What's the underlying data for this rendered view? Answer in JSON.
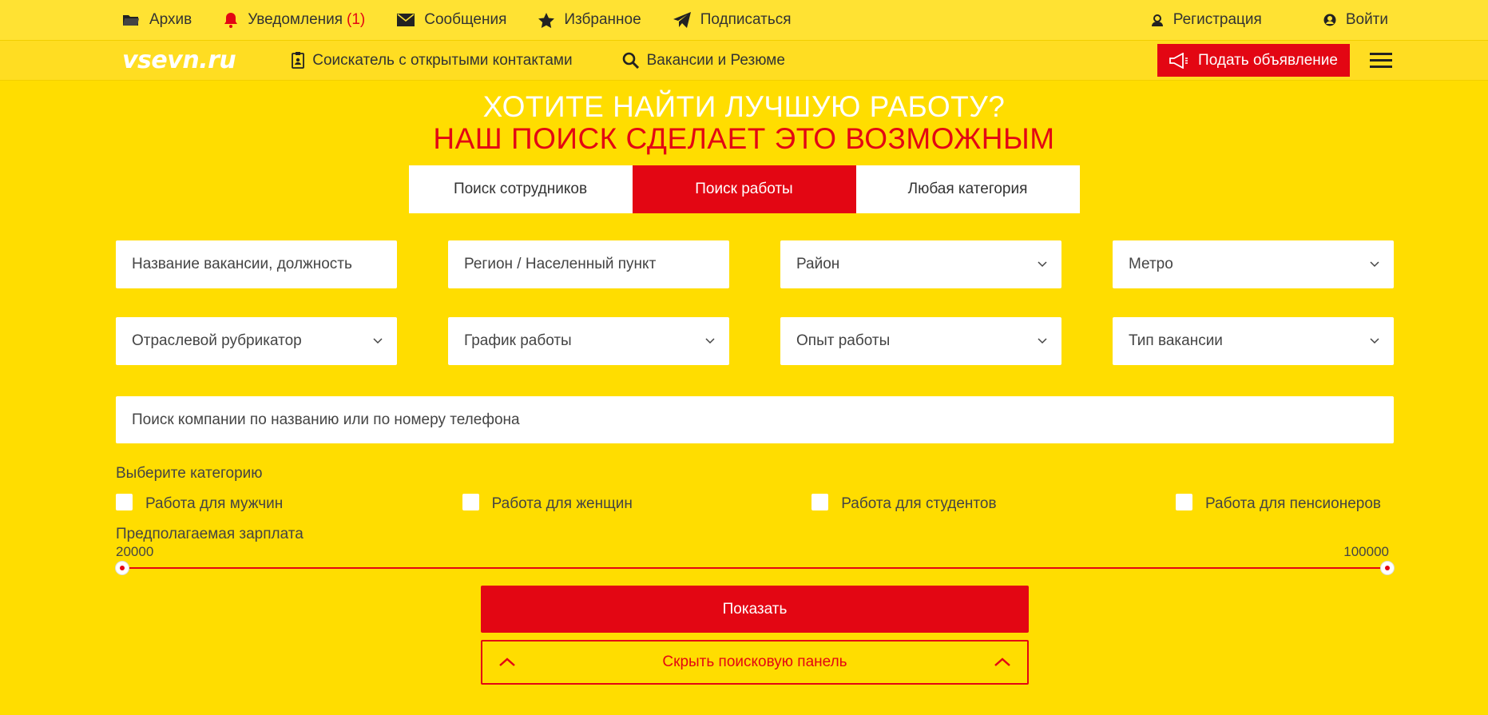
{
  "topbar": {
    "archive": "Архив",
    "notifications": "Уведомления",
    "notifications_count": "(1)",
    "messages": "Сообщения",
    "favorites": "Избранное",
    "subscribe": "Подписаться",
    "register": "Регистрация",
    "login": "Войти"
  },
  "navbar": {
    "logo": "vsevn.ru",
    "open_contacts": "Соискатель с открытыми контактами",
    "search_link": "Вакансии и Резюме",
    "post_button": "Подать объявление"
  },
  "hero": {
    "line1": "ХОТИТЕ НАЙТИ ЛУЧШУЮ РАБОТУ?",
    "line2": "НАШ ПОИСК СДЕЛАЕТ ЭТО ВОЗМОЖНЫМ"
  },
  "tabs": [
    {
      "label": "Поиск сотрудников",
      "active": false
    },
    {
      "label": "Поиск работы",
      "active": true
    },
    {
      "label": "Любая категория",
      "active": false
    }
  ],
  "fields": {
    "vacancy": "Название вакансии, должность",
    "region": "Регион / Населенный пункт",
    "district": "Район",
    "metro": "Метро",
    "industry": "Отраслевой рубрикатор",
    "schedule": "График работы",
    "experience": "Опыт работы",
    "vacancy_type": "Тип вакансии",
    "company_search": "Поиск компании по названию или по номеру телефона"
  },
  "categories": {
    "title": "Выберите категорию",
    "items": [
      "Работа для мужчин",
      "Работа для женщин",
      "Работа для студентов",
      "Работа для пенсионеров"
    ]
  },
  "salary": {
    "title": "Предполагаемая зарплата",
    "min": "20000",
    "max": "100000"
  },
  "buttons": {
    "show": "Показать",
    "hide": "Скрыть поисковую панель"
  },
  "colors": {
    "background": "#FFDD00",
    "accent": "#E30613"
  }
}
